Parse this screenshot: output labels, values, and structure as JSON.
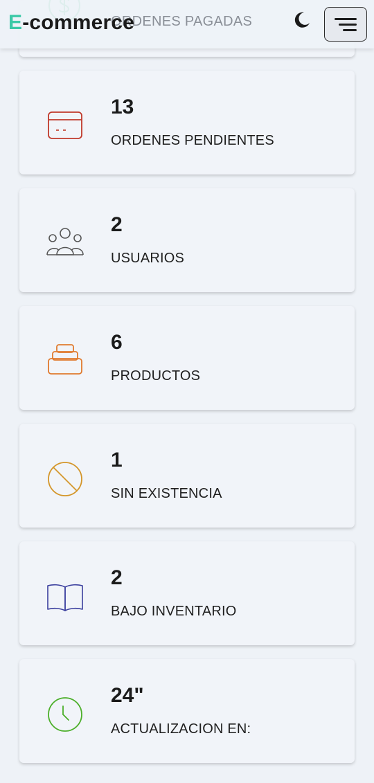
{
  "header": {
    "logo_letter": "E",
    "logo_rest": "-commerce",
    "theme_toggle_icon": "moon-icon",
    "menu_icon": "hamburger-menu-icon"
  },
  "behind_card": {
    "icon": "dollar-icon",
    "icon_color": "#2eb872",
    "label": "ORDENES PAGADAS"
  },
  "cards": [
    {
      "value": "13",
      "label": "ORDENES PENDIENTES",
      "icon": "credit-card-icon",
      "color": "#c0392b"
    },
    {
      "value": "2",
      "label": "USUARIOS",
      "icon": "users-icon",
      "color": "#555555"
    },
    {
      "value": "6",
      "label": "PRODUCTOS",
      "icon": "box-stack-icon",
      "color": "#e07a2e"
    },
    {
      "value": "1",
      "label": "SIN EXISTENCIA",
      "icon": "ban-icon",
      "color": "#d4962a"
    },
    {
      "value": "2",
      "label": "BAJO INVENTARIO",
      "icon": "book-icon",
      "color": "#3b3f9e"
    },
    {
      "value": "24\"",
      "label": "ACTUALIZACION EN:",
      "icon": "clock-icon",
      "color": "#4caf2a"
    }
  ]
}
